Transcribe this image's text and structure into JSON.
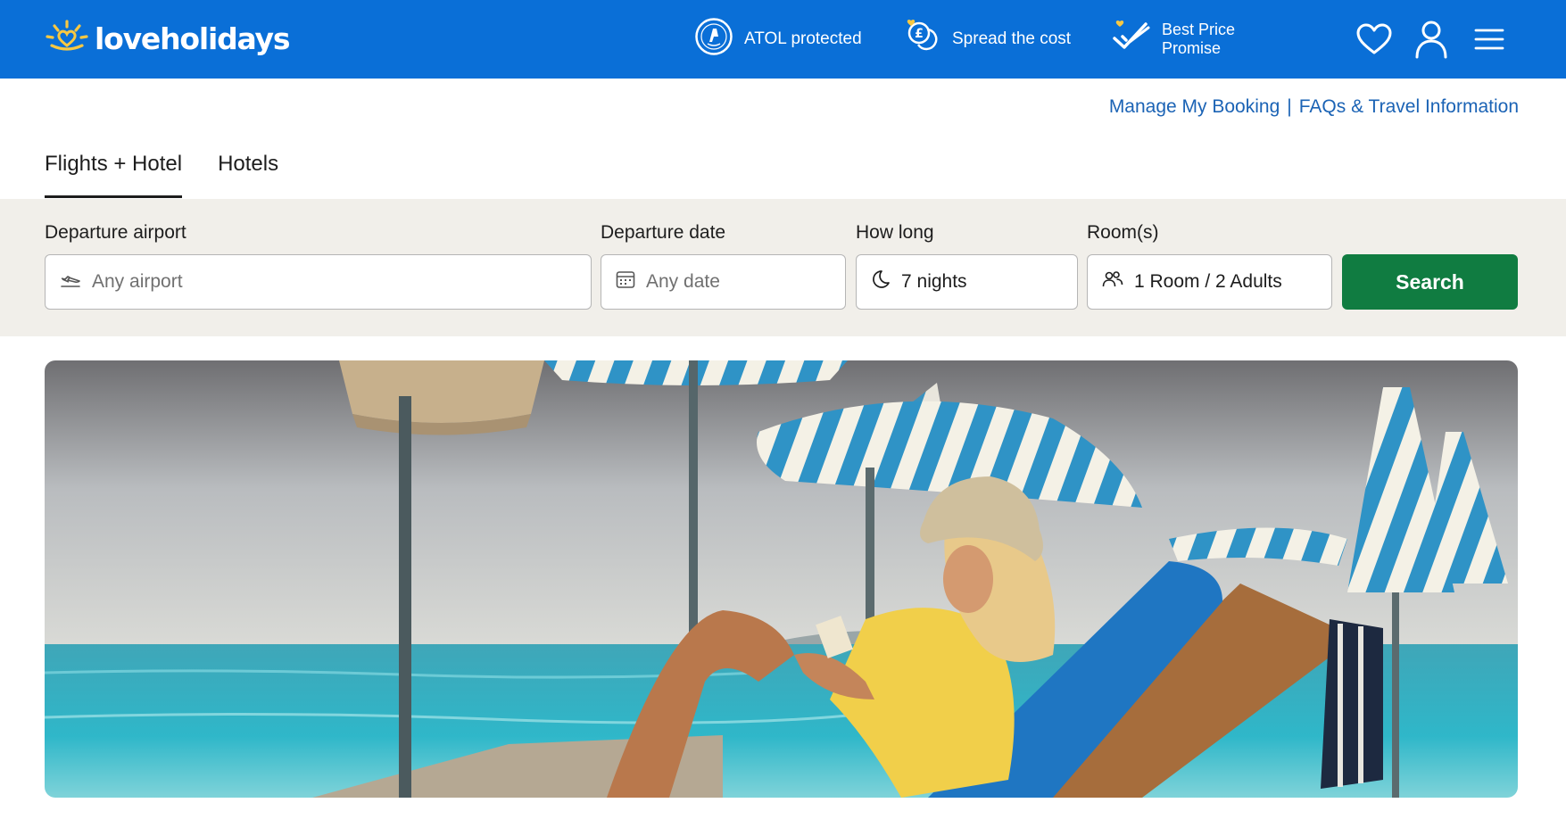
{
  "header": {
    "logo_text": "loveholidays",
    "usps": [
      {
        "label": "ATOL protected",
        "icon": "atol-badge-icon"
      },
      {
        "label": "Spread the cost",
        "icon": "coins-pound-icon"
      },
      {
        "label_line1": "Best Price",
        "label_line2": "Promise",
        "icon": "double-check-icon"
      }
    ],
    "icons": [
      "heart-icon",
      "user-icon",
      "hamburger-menu-icon"
    ]
  },
  "utility_links": {
    "manage": "Manage My Booking",
    "separator": "|",
    "faqs": "FAQs & Travel Information"
  },
  "tabs": [
    {
      "label": "Flights + Hotel",
      "active": true
    },
    {
      "label": "Hotels",
      "active": false
    }
  ],
  "search": {
    "departure_airport": {
      "label": "Departure airport",
      "placeholder": "Any airport"
    },
    "departure_date": {
      "label": "Departure date",
      "placeholder": "Any date"
    },
    "how_long": {
      "label": "How long",
      "value": "7 nights"
    },
    "rooms": {
      "label": "Room(s)",
      "value": "1 Room / 2 Adults"
    },
    "button": "Search"
  },
  "colors": {
    "brand_blue": "#0a6fd7",
    "link_blue": "#1b63b5",
    "search_green": "#107c41",
    "panel_beige": "#f1efea",
    "logo_yellow": "#f7c843"
  }
}
